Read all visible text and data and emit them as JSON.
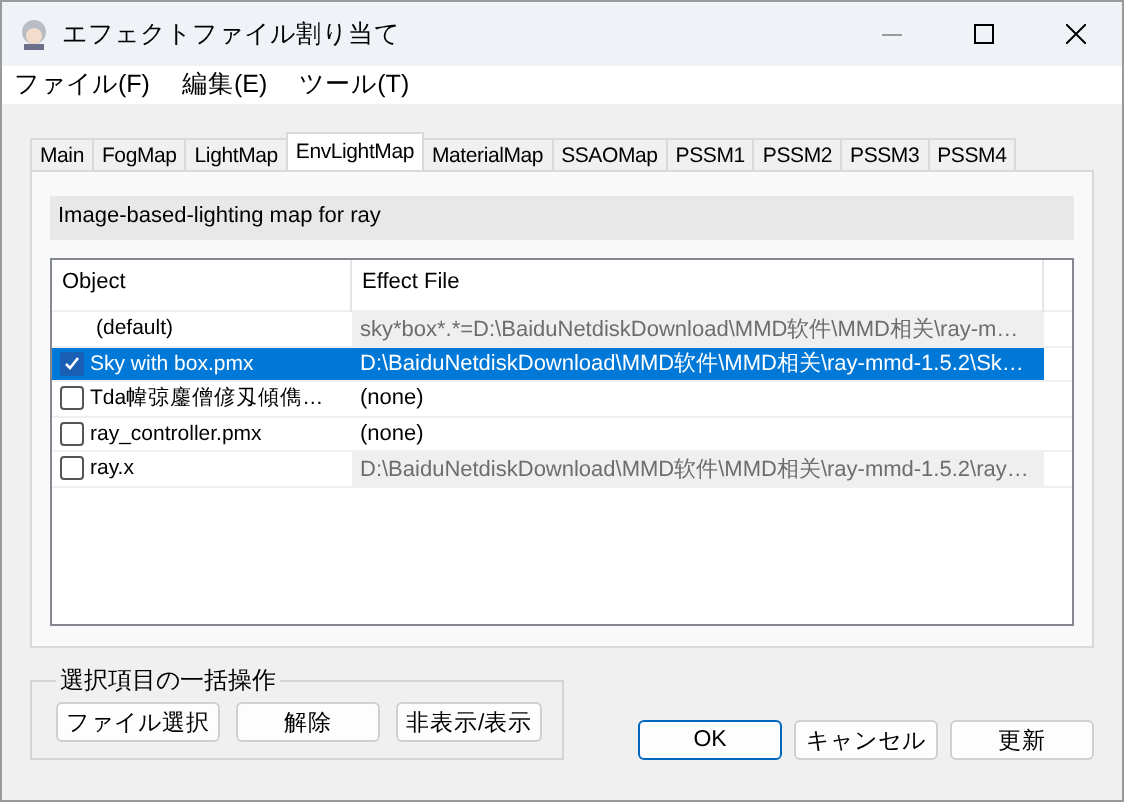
{
  "window": {
    "title": "エフェクトファイル割り当て"
  },
  "menu": [
    "ファイル(F)",
    "編集(E)",
    "ツール(T)"
  ],
  "tabs": [
    {
      "label": "Main",
      "selected": false
    },
    {
      "label": "FogMap",
      "selected": false
    },
    {
      "label": "LightMap",
      "selected": false
    },
    {
      "label": "EnvLightMap",
      "selected": true
    },
    {
      "label": "MaterialMap",
      "selected": false
    },
    {
      "label": "SSAOMap",
      "selected": false
    },
    {
      "label": "PSSM1",
      "selected": false
    },
    {
      "label": "PSSM2",
      "selected": false
    },
    {
      "label": "PSSM3",
      "selected": false
    },
    {
      "label": "PSSM4",
      "selected": false
    }
  ],
  "description": "Image-based-lighting map for ray",
  "table": {
    "columns": [
      "Object",
      "Effect File"
    ],
    "rows": [
      {
        "kind": "default",
        "object": "(default)",
        "effect": "sky*box*.*=D:\\BaiduNetdiskDownload\\MMD软件\\MMD相关\\ray-m…",
        "inherited": true,
        "selected": false
      },
      {
        "kind": "item",
        "checked": true,
        "object": "Sky with box.pmx",
        "effect": "D:\\BaiduNetdiskDownload\\MMD软件\\MMD相关\\ray-mmd-1.5.2\\Sk…",
        "inherited": false,
        "selected": true
      },
      {
        "kind": "item",
        "checked": false,
        "object": "Tda幃弶鏖僧偐刄傾儁…",
        "effect": "(none)",
        "inherited": false,
        "selected": false
      },
      {
        "kind": "item",
        "checked": false,
        "object": "ray_controller.pmx",
        "effect": "(none)",
        "inherited": false,
        "selected": false
      },
      {
        "kind": "item",
        "checked": false,
        "object": "ray.x",
        "effect": "D:\\BaiduNetdiskDownload\\MMD软件\\MMD相关\\ray-mmd-1.5.2\\ray…",
        "inherited": true,
        "selected": false
      }
    ]
  },
  "bulk": {
    "title": "選択項目の一括操作",
    "buttons": [
      "ファイル選択",
      "解除",
      "非表示/表示"
    ]
  },
  "buttons": [
    {
      "label": "OK",
      "default": true
    },
    {
      "label": "キャンセル",
      "default": false
    },
    {
      "label": "更新",
      "default": false
    }
  ]
}
